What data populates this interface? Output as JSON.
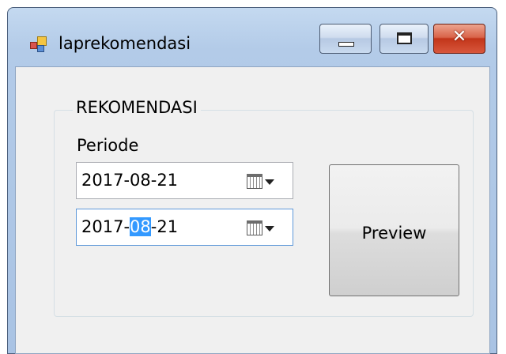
{
  "window": {
    "title": "laprekomendasi",
    "controls": {
      "minimize_icon": "minimize-icon",
      "maximize_icon": "maximize-icon",
      "close_icon": "close-icon",
      "close_glyph": "✕"
    }
  },
  "form": {
    "group_title": "REKOMENDASI",
    "period_label": "Periode",
    "date_from": {
      "value": "2017-08-21",
      "icon": "calendar-icon"
    },
    "date_to": {
      "prefix": "2017-",
      "selected": "08",
      "suffix": "-21",
      "icon": "calendar-icon"
    },
    "preview_button": "Preview"
  },
  "colors": {
    "selection": "#3399ff",
    "client_bg": "#f0f0f0",
    "close_button": "#c2351a"
  }
}
